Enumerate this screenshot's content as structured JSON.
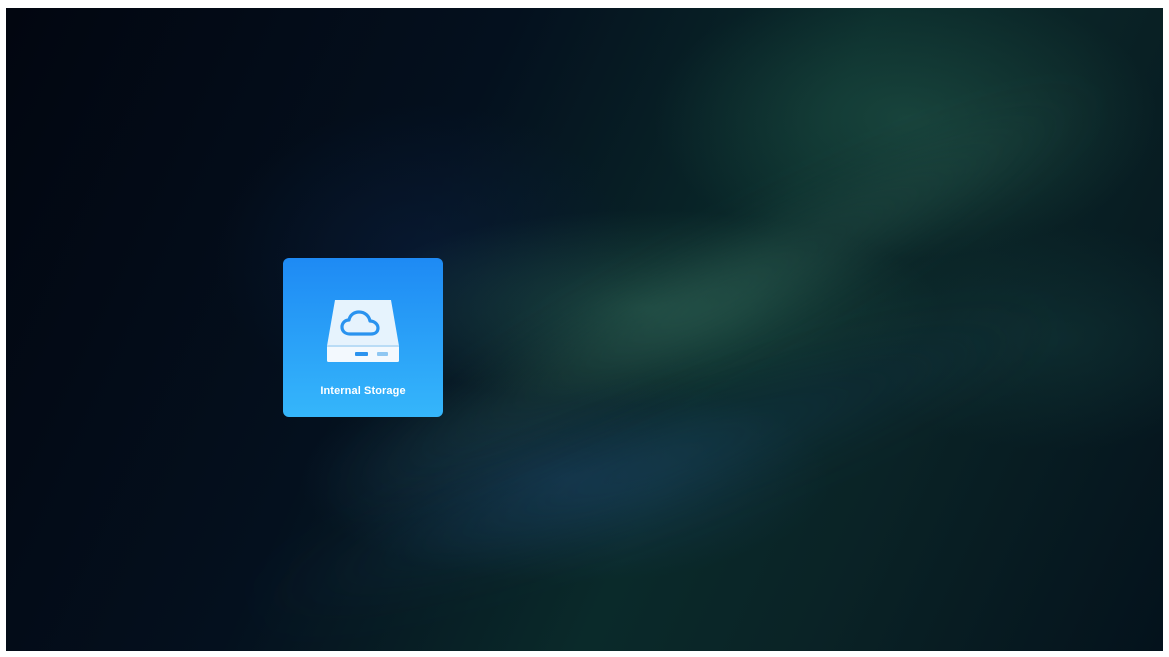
{
  "storage_tiles": [
    {
      "label": "Internal Storage",
      "icon": "hard-drive-cloud-icon"
    }
  ],
  "colors": {
    "tile_top": "#1e8af4",
    "tile_bottom": "#35b6fb",
    "label": "#ffffff"
  }
}
